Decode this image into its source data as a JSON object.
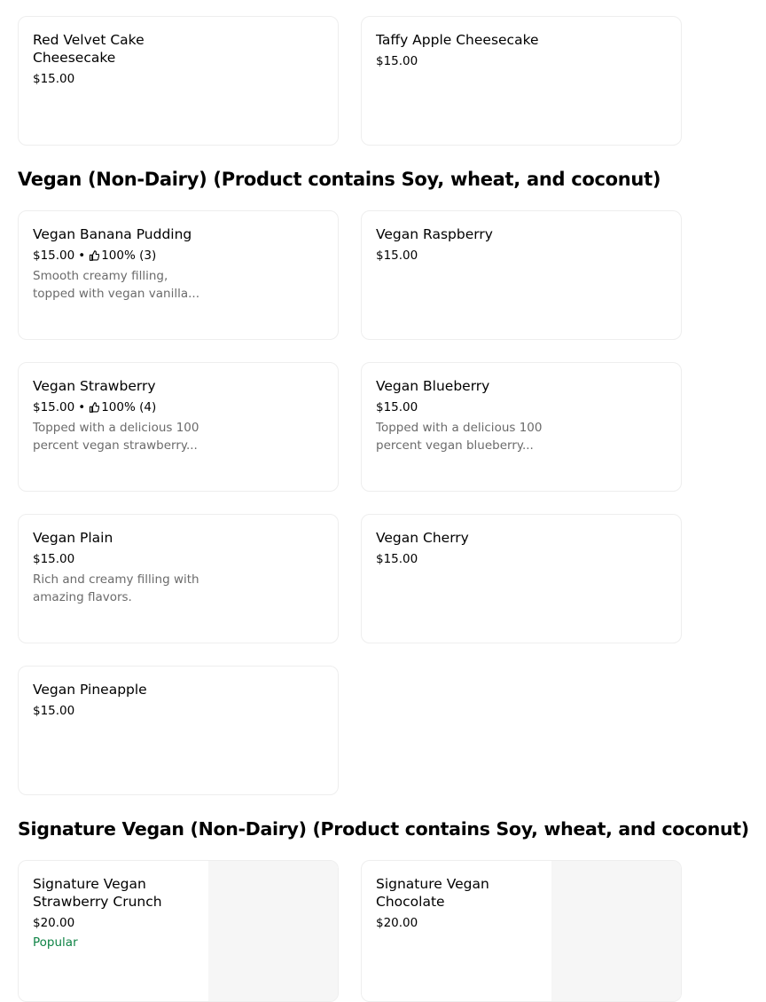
{
  "cards_top": [
    {
      "title": "Red Velvet Cake Cheesecake",
      "price": "$15.00"
    },
    {
      "title": "Taffy Apple Cheesecake",
      "price": "$15.00"
    }
  ],
  "section_vegan": {
    "title": "Vegan (Non-Dairy) (Product contains Soy, wheat, and coconut)",
    "items": [
      {
        "title": "Vegan Banana Pudding",
        "price": "$15.00",
        "separator": "•",
        "rating": "100% (3)",
        "description": "Smooth creamy filling, topped with vegan vanilla..."
      },
      {
        "title": "Vegan Raspberry",
        "price": "$15.00"
      },
      {
        "title": "Vegan Strawberry",
        "price": "$15.00",
        "separator": "•",
        "rating": "100% (4)",
        "description": "Topped with a delicious 100 percent vegan strawberry..."
      },
      {
        "title": "Vegan Blueberry",
        "price": "$15.00",
        "description": "Topped with a delicious 100 percent vegan blueberry..."
      },
      {
        "title": "Vegan Plain",
        "price": "$15.00",
        "description": "Rich and creamy filling with amazing flavors."
      },
      {
        "title": "Vegan Cherry",
        "price": "$15.00"
      },
      {
        "title": "Vegan Pineapple",
        "price": "$15.00"
      }
    ]
  },
  "section_signature": {
    "title": "Signature Vegan (Non-Dairy) (Product contains Soy, wheat, and coconut)",
    "items": [
      {
        "title": "Signature Vegan Strawberry Crunch",
        "price": "$20.00",
        "badge": "Popular"
      },
      {
        "title": "Signature Vegan Chocolate",
        "price": "$20.00"
      }
    ]
  },
  "colors": {
    "popular": "#0e8345",
    "description": "#6b6b6b",
    "border": "#eeeeee"
  },
  "icons": {
    "rating": "thumbs-up-icon"
  }
}
